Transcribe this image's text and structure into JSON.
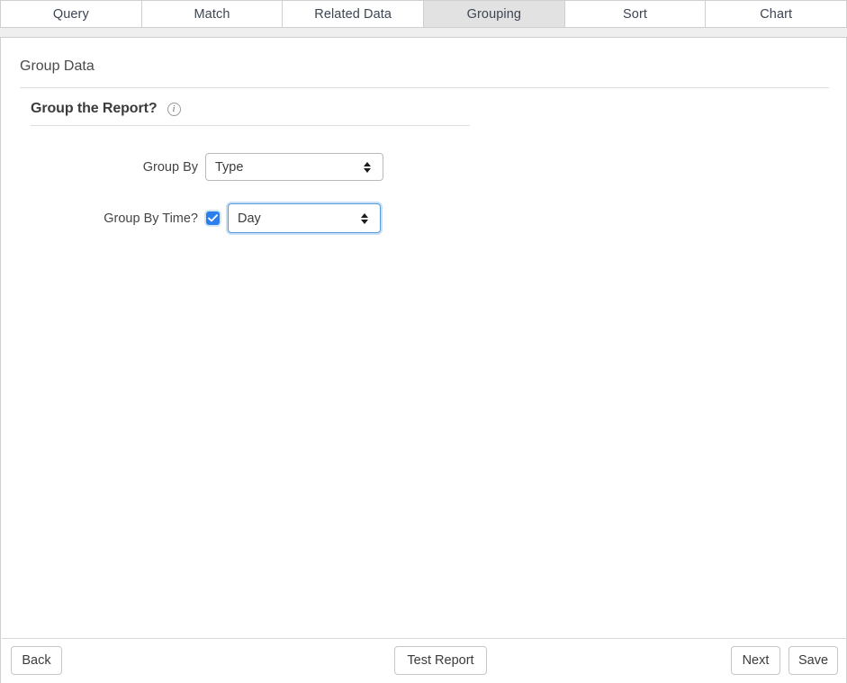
{
  "tabs": [
    {
      "label": "Query",
      "active": false
    },
    {
      "label": "Match",
      "active": false
    },
    {
      "label": "Related Data",
      "active": false
    },
    {
      "label": "Grouping",
      "active": true
    },
    {
      "label": "Sort",
      "active": false
    },
    {
      "label": "Chart",
      "active": false
    }
  ],
  "panel": {
    "section_title": "Group Data",
    "sub_title": "Group the Report?",
    "info_icon_glyph": "i"
  },
  "form": {
    "group_by": {
      "label": "Group By",
      "value": "Type",
      "options": [
        "Type"
      ]
    },
    "group_by_time": {
      "label": "Group By Time?",
      "checked": true,
      "value": "Day",
      "options": [
        "Day"
      ]
    }
  },
  "footer": {
    "back_label": "Back",
    "test_report_label": "Test Report",
    "next_label": "Next",
    "save_label": "Save"
  },
  "colors": {
    "accent": "#2a7fec",
    "focus_border": "#5a9bd8",
    "active_tab_bg": "#e2e2e2",
    "page_bg": "#efefef",
    "border": "#cfcfcf"
  }
}
